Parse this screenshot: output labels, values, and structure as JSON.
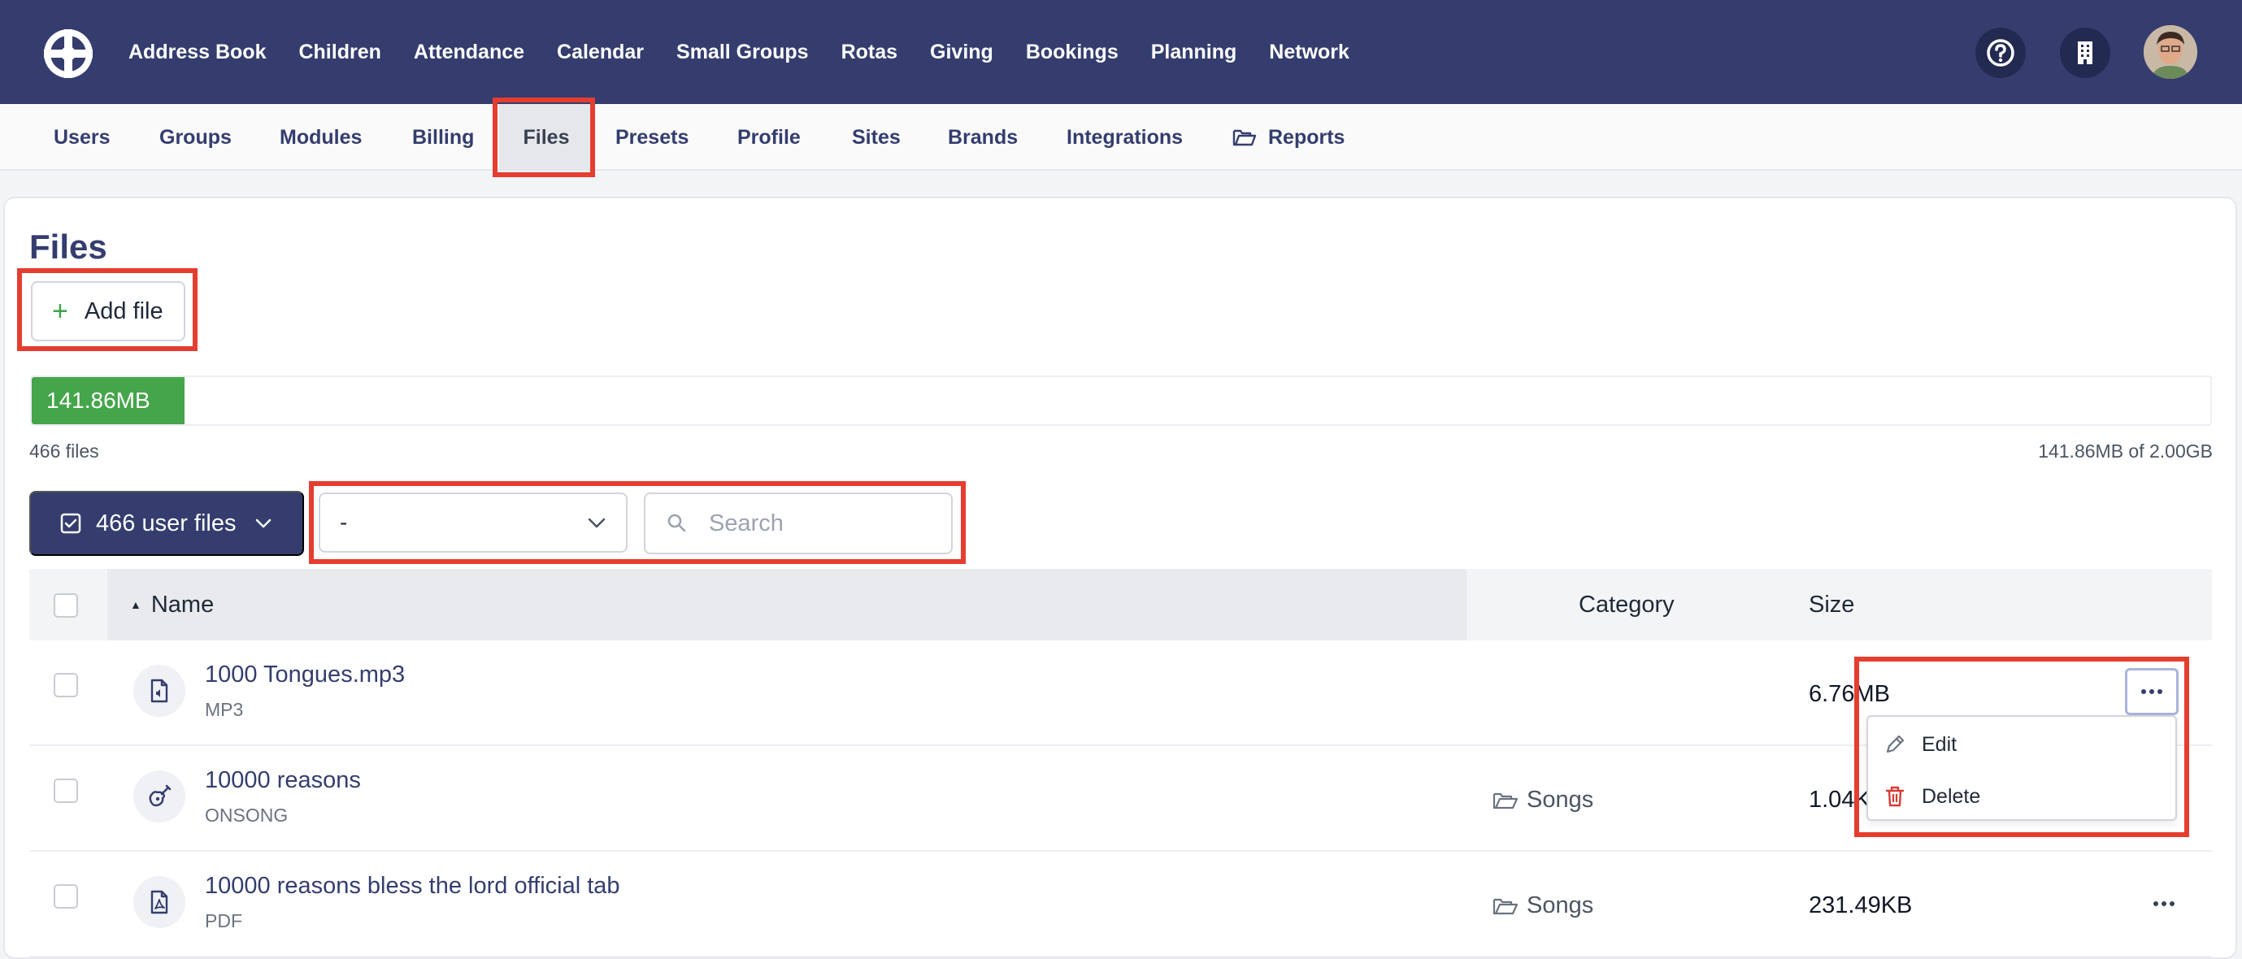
{
  "colors": {
    "nav_bg": "#343d6e",
    "accent_green": "#45a54b",
    "highlight_red": "#e53d2f",
    "delete_red": "#d63b36"
  },
  "topnav": {
    "items": [
      "Address Book",
      "Children",
      "Attendance",
      "Calendar",
      "Small Groups",
      "Rotas",
      "Giving",
      "Bookings",
      "Planning",
      "Network"
    ],
    "icons": [
      "help-circle-icon",
      "building-icon"
    ]
  },
  "subnav": {
    "items": [
      {
        "label": "Users"
      },
      {
        "label": "Groups"
      },
      {
        "label": "Modules"
      },
      {
        "label": "Billing"
      },
      {
        "label": "Files",
        "active": true
      },
      {
        "label": "Presets"
      },
      {
        "label": "Profile"
      },
      {
        "label": "Sites"
      },
      {
        "label": "Brands"
      },
      {
        "label": "Integrations"
      },
      {
        "label": "Reports",
        "icon": "folder-open-icon"
      }
    ]
  },
  "page": {
    "title": "Files",
    "add_button_label": "Add file"
  },
  "storage": {
    "used_label": "141.86MB",
    "used_fraction": 0.07,
    "files_count_text": "466 files",
    "summary_text": "141.86MB of 2.00GB"
  },
  "filters": {
    "user_files_label": "466 user files",
    "category_select_value": "-",
    "search_placeholder": "Search"
  },
  "table": {
    "columns": [
      "Name",
      "Category",
      "Size"
    ],
    "rows": [
      {
        "name": "1000 Tongues.mp3",
        "type": "MP3",
        "category": "",
        "size": "6.76MB",
        "icon": "audio-file-icon"
      },
      {
        "name": "10000 reasons",
        "type": "ONSONG",
        "category": "Songs",
        "size": "1.04KB",
        "icon": "guitar-icon"
      },
      {
        "name": "10000 reasons bless the lord official tab",
        "type": "PDF",
        "category": "Songs",
        "size": "231.49KB",
        "icon": "pdf-file-icon"
      }
    ]
  },
  "row_menu": {
    "edit_label": "Edit",
    "delete_label": "Delete"
  }
}
